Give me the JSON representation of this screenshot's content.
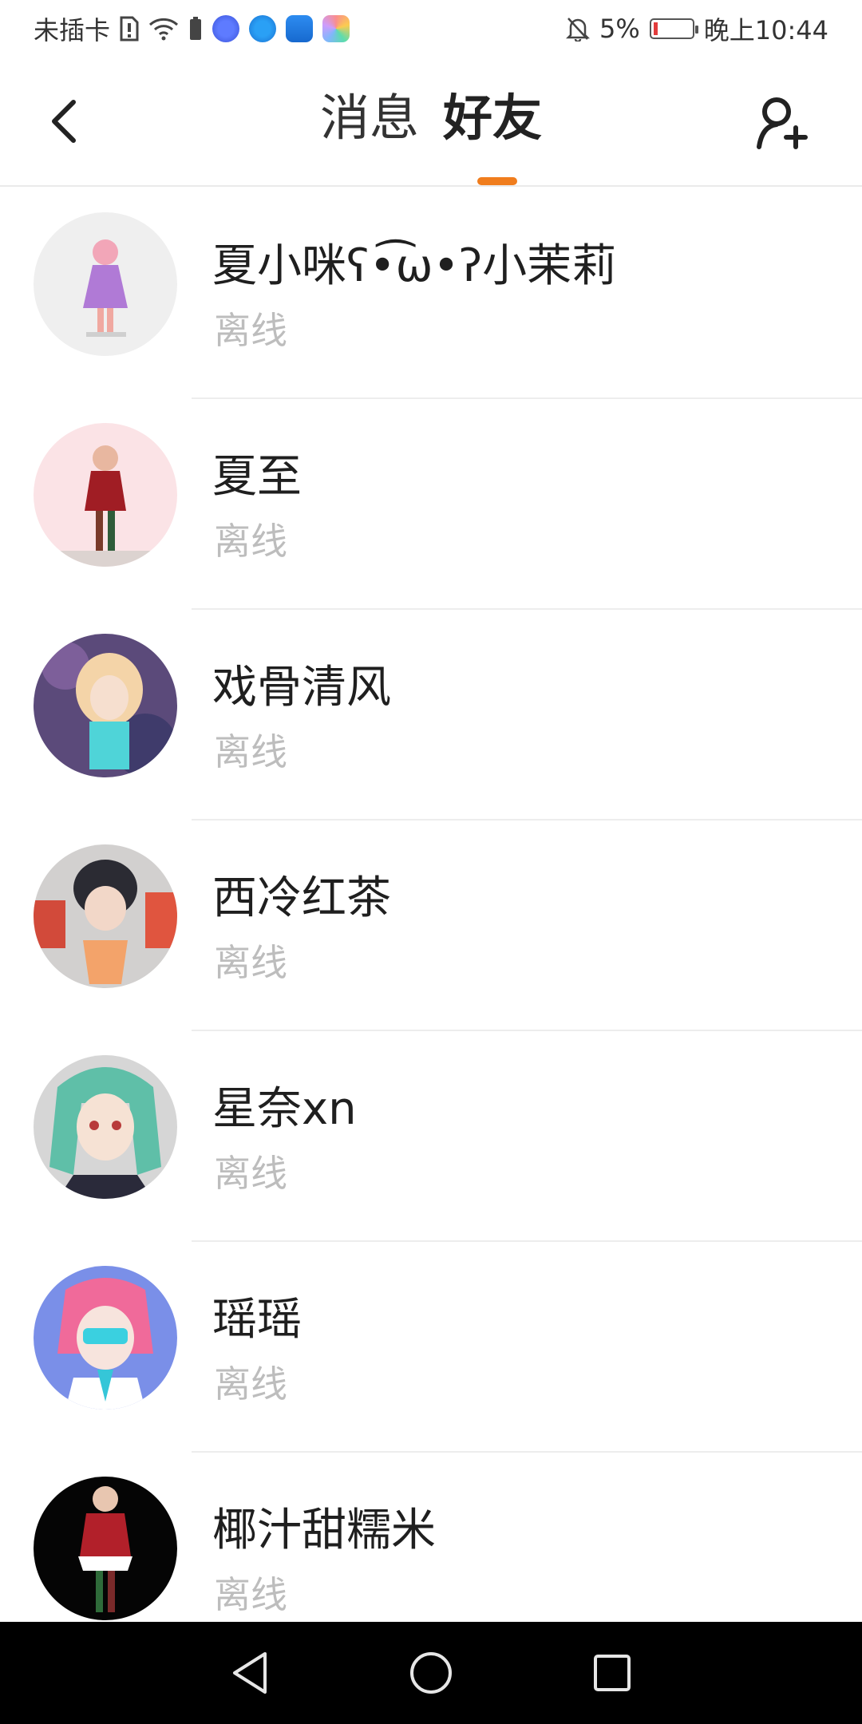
{
  "status_bar": {
    "carrier": "未插卡",
    "battery_percent": "5%",
    "time": "晚上10:44",
    "icons": [
      "sim-missing-icon",
      "wifi-icon",
      "battery-saver-icon",
      "music-app-icon",
      "browser-app-icon",
      "weather-app-icon",
      "gallery-app-icon",
      "mute-bell-icon",
      "battery-icon"
    ],
    "battery_level": 0.05
  },
  "header": {
    "tabs": [
      {
        "label": "消息",
        "active": false
      },
      {
        "label": "好友",
        "active": true
      }
    ],
    "accent_color": "#f07d1d",
    "back_icon": "chevron-left-icon",
    "add_icon": "add-user-icon"
  },
  "friends": [
    {
      "name": "夏小咪ʕ•͡ω•ʔ小茉莉",
      "status": "离线",
      "avatar_bg": "#efefef"
    },
    {
      "name": "夏至",
      "status": "离线",
      "avatar_bg": "#fbe3e6"
    },
    {
      "name": "戏骨清风",
      "status": "离线",
      "avatar_bg": "#5b4a7a"
    },
    {
      "name": "西冷红茶",
      "status": "离线",
      "avatar_bg": "#c85a48"
    },
    {
      "name": "星奈xn",
      "status": "离线",
      "avatar_bg": "#d6d6d6"
    },
    {
      "name": "瑶瑶",
      "status": "离线",
      "avatar_bg": "#7a8fe8"
    },
    {
      "name": "椰汁甜糯米",
      "status": "离线",
      "avatar_bg": "#050505"
    }
  ],
  "nav_bar": {
    "buttons": [
      "back-triangle-icon",
      "home-circle-icon",
      "recents-square-icon"
    ]
  }
}
